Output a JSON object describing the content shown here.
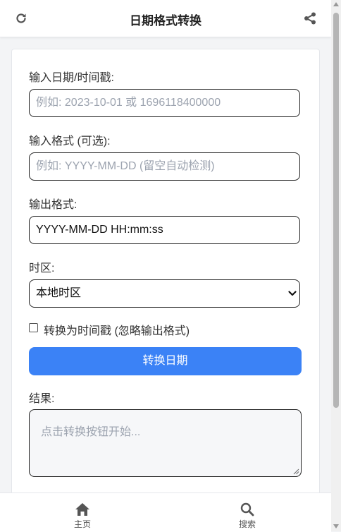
{
  "header": {
    "title": "日期格式转换",
    "refresh_icon": "refresh-icon",
    "share_icon": "share-icon"
  },
  "form": {
    "date_input": {
      "label": "输入日期/时间戳:",
      "value": "",
      "placeholder": "例如: 2023-10-01 或 1696118400000"
    },
    "input_format": {
      "label": "输入格式 (可选):",
      "value": "",
      "placeholder": "例如: YYYY-MM-DD (留空自动检测)"
    },
    "output_format": {
      "label": "输出格式:",
      "value": "YYYY-MM-DD HH:mm:ss"
    },
    "timezone": {
      "label": "时区:",
      "selected": "本地时区"
    },
    "to_timestamp": {
      "label": "转换为时间戳 (忽略输出格式)",
      "checked": false
    },
    "convert_button": "转换日期",
    "result": {
      "label": "结果:",
      "placeholder": "点击转换按钮开始..."
    }
  },
  "bottom_nav": {
    "items": [
      {
        "label": "主页",
        "icon": "home-icon"
      },
      {
        "label": "搜索",
        "icon": "search-icon"
      }
    ]
  },
  "colors": {
    "accent": "#3b82f6",
    "background": "#f3f4f6",
    "card": "#ffffff"
  }
}
